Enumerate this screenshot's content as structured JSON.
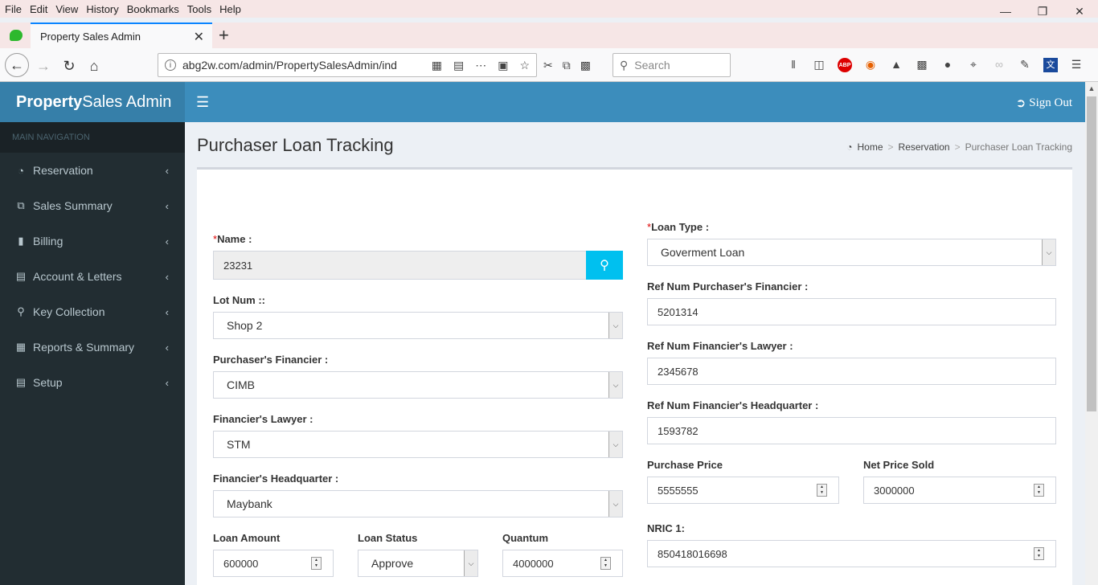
{
  "browser": {
    "menu": [
      "File",
      "Edit",
      "View",
      "History",
      "Bookmarks",
      "Tools",
      "Help"
    ],
    "tab_title": "Property Sales Admin",
    "url": "abg2w.com/admin/PropertySalesAdmin/ind",
    "search_placeholder": "Search"
  },
  "app": {
    "logo_bold": "Property",
    "logo_rest": "Sales Admin",
    "signout_label": "Sign Out"
  },
  "sidebar": {
    "header": "MAIN NAVIGATION",
    "items": [
      {
        "label": "Reservation",
        "icon": "dashboard-icon"
      },
      {
        "label": "Sales Summary",
        "icon": "copy-icon"
      },
      {
        "label": "Billing",
        "icon": "file-icon"
      },
      {
        "label": "Account & Letters",
        "icon": "laptop-icon"
      },
      {
        "label": "Key Collection",
        "icon": "key-icon"
      },
      {
        "label": "Reports & Summary",
        "icon": "report-icon"
      },
      {
        "label": "Setup",
        "icon": "laptop-icon"
      }
    ]
  },
  "page": {
    "title": "Purchaser Loan Tracking",
    "breadcrumb": [
      "Home",
      "Reservation",
      "Purchaser Loan Tracking"
    ]
  },
  "form": {
    "name": {
      "label": "Name :",
      "value": "23231"
    },
    "lot_num": {
      "label": "Lot Num ::",
      "value": "Shop 2"
    },
    "purchaser_financier": {
      "label": "Purchaser's Financier :",
      "value": "CIMB"
    },
    "financier_lawyer": {
      "label": "Financier's Lawyer :",
      "value": "STM"
    },
    "financier_hq": {
      "label": "Financier's Headquarter :",
      "value": "Maybank"
    },
    "loan_amount": {
      "label": "Loan Amount",
      "value": "600000"
    },
    "loan_status": {
      "label": "Loan Status",
      "value": "Approve"
    },
    "quantum": {
      "label": "Quantum",
      "value": "4000000"
    },
    "loan_type": {
      "label": "Loan Type :",
      "value": "Goverment Loan"
    },
    "ref_purchaser_financier": {
      "label": "Ref Num Purchaser's Financier :",
      "value": "5201314"
    },
    "ref_financier_lawyer": {
      "label": "Ref Num Financier's Lawyer :",
      "value": "2345678"
    },
    "ref_financier_hq": {
      "label": "Ref Num Financier's Headquarter :",
      "value": "1593782"
    },
    "purchase_price": {
      "label": "Purchase Price",
      "value": "5555555"
    },
    "net_price_sold": {
      "label": "Net Price Sold",
      "value": "3000000"
    },
    "nric1": {
      "label": "NRIC 1:",
      "value": "850418016698"
    }
  }
}
